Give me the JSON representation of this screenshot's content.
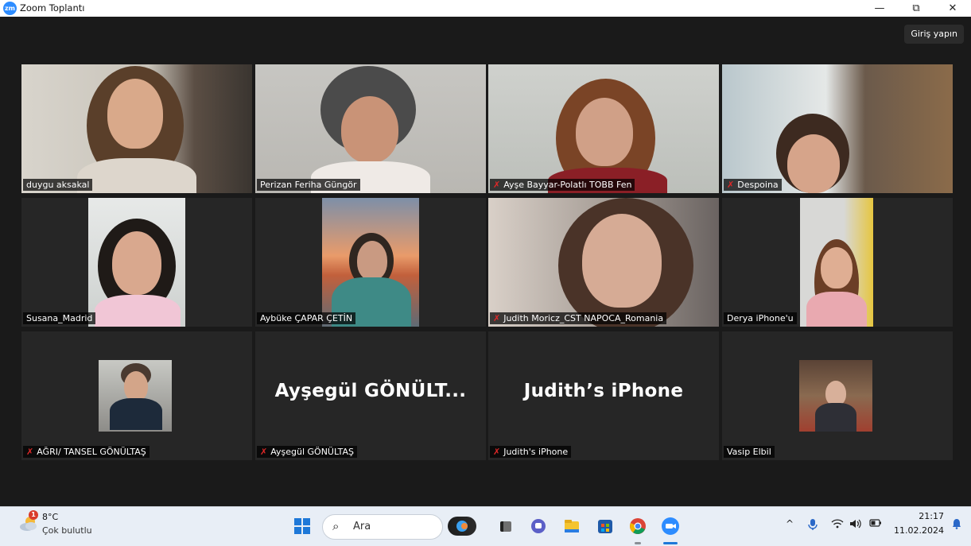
{
  "window": {
    "logo_text": "zm",
    "title": "Zoom Toplantı",
    "minimize_glyph": "—",
    "restore_glyph": "⧉",
    "close_glyph": "✕"
  },
  "meeting": {
    "signin_label": "Giriş yapın",
    "active_speaker_color": "#d8e86a",
    "muted_icon": "muted-mic-icon",
    "muted_color": "#e02828",
    "participants": [
      {
        "name": "duygu aksakal",
        "muted": false,
        "active": true
      },
      {
        "name": "Perizan Feriha Güngör",
        "muted": false
      },
      {
        "name": "Ayşe Bayyar-Polatlı TOBB Fen",
        "muted": true
      },
      {
        "name": "Despoina",
        "muted": true
      },
      {
        "name": "Susana_Madrid",
        "muted": false
      },
      {
        "name": "Aybüke ÇAPAR ÇETİN",
        "muted": false
      },
      {
        "name": "Judith Moricz_CST NAPOCA_Romania",
        "muted": true
      },
      {
        "name": "Derya iPhone'u",
        "muted": false
      },
      {
        "name": "AĞRI/ TANSEL GÖNÜLTAŞ",
        "muted": true
      },
      {
        "name": "Ayşegül GÖNÜLTAŞ",
        "muted": true,
        "display": "Ayşegül  GÖNÜLT..."
      },
      {
        "name": "Judith's iPhone",
        "muted": true,
        "display": "Judith’s iPhone"
      },
      {
        "name": "Vasip Elbil",
        "muted": false
      }
    ]
  },
  "taskbar": {
    "weather": {
      "temp": "8°C",
      "desc": "Çok bulutlu",
      "badge": "1",
      "icon": "cloud-sun-icon"
    },
    "search_placeholder": "Ara",
    "apps": [
      "copilot-icon",
      "task-view-icon",
      "teams-chat-icon",
      "file-explorer-icon",
      "store-icon",
      "chrome-icon",
      "zoom-icon"
    ],
    "tray": {
      "chevron": "^",
      "mic": "mic-icon",
      "wifi": "wifi-icon",
      "volume": "volume-icon",
      "battery": "battery-icon"
    },
    "time": "21:17",
    "date": "11.02.2024"
  }
}
